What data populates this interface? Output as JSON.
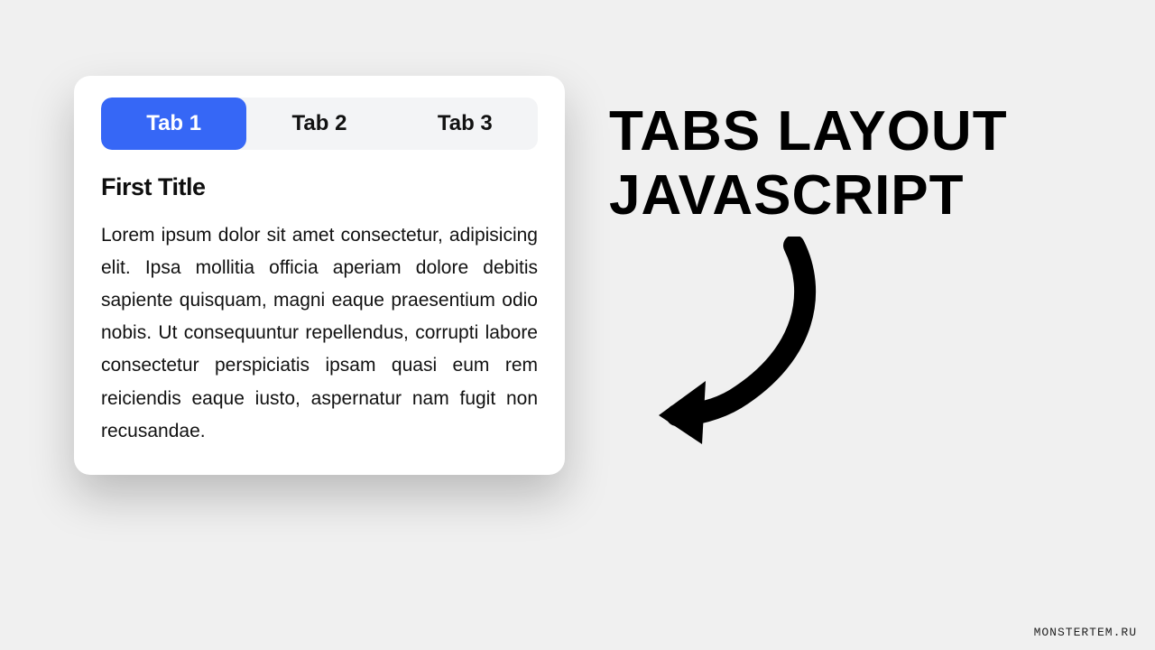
{
  "headline": "TABS LAYOUT JAVASCRIPT",
  "tabs": [
    {
      "label": "Tab 1",
      "active": true
    },
    {
      "label": "Tab 2",
      "active": false
    },
    {
      "label": "Tab 3",
      "active": false
    }
  ],
  "content": {
    "title": "First Title",
    "body": "Lorem ipsum dolor sit amet consectetur, adipisicing elit. Ipsa mollitia officia aperiam dolore debitis sapiente quisquam, magni eaque praesentium odio nobis. Ut consequuntur repellendus, corrupti labore consectetur perspiciatis ipsam quasi eum rem reiciendis eaque iusto, aspernatur nam fugit non recusandae."
  },
  "watermark": "MONSTERTEM.RU",
  "colors": {
    "accent": "#3667f6",
    "card_bg": "#ffffff",
    "page_bg": "#f0f0f0",
    "tab_bg": "#f3f4f6"
  }
}
